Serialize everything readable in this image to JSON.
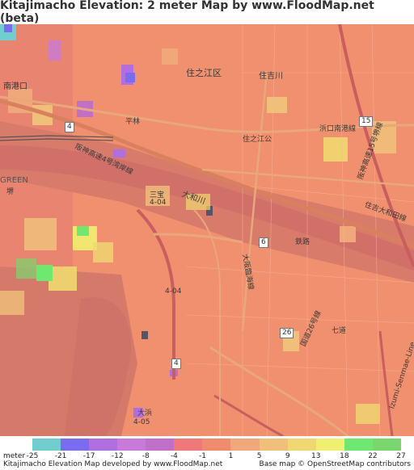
{
  "title": "Kitajimacho Elevation: 2 meter Map by www.FloodMap.net (beta)",
  "map": {
    "labels": {
      "sumiyoshi_river_jp": "住吉川",
      "suminoe_ward": "住之江区",
      "nankoguchi": "南港口",
      "hirabayashi": "平林",
      "green": "GREEN",
      "hamaguchi_nanko_line": "浜口南港線",
      "suminoe_koen": "住之江公",
      "yamato_river": "大和川",
      "sumiyoshi_ota_line": "住吉大和田線",
      "sanpo": "三宝",
      "ichi_04": "4-04",
      "tetsudo": "鉄路",
      "nanachome": "七道",
      "fukuro": "4-05",
      "rinkaisen": "大阪臨海線",
      "otsuka": "大浜",
      "hanshin_expwy_sakai": "阪神高速4号湾岸線",
      "kanjo_26": "国道26号線",
      "hanshin_15": "阪神高速15号堺線",
      "sakai": "堺",
      "izumi_senmaru": "Izumi-Senmae-Line"
    },
    "route_shields": {
      "r4a": "4",
      "r4b": "4",
      "r15": "15",
      "r6": "6",
      "r26": "26"
    }
  },
  "legend": {
    "unit_label": "meter",
    "ticks": [
      "-25",
      "-21",
      "-17",
      "-12",
      "-8",
      "-4",
      "-1",
      "1",
      "5",
      "9",
      "13",
      "18",
      "22",
      "27"
    ],
    "colors": [
      "#6fcfcf",
      "#7a6cf0",
      "#b06ee0",
      "#c87ad8",
      "#c070c8",
      "#f07878",
      "#f08c6e",
      "#f0a87a",
      "#f0c07a",
      "#f0d870",
      "#f0f070",
      "#6ee86e",
      "#78d86e"
    ],
    "footer_left": "Kitajimacho Elevation Map developed by www.FloodMap.net",
    "footer_right": "Base map © OpenStreetMap contributors"
  }
}
